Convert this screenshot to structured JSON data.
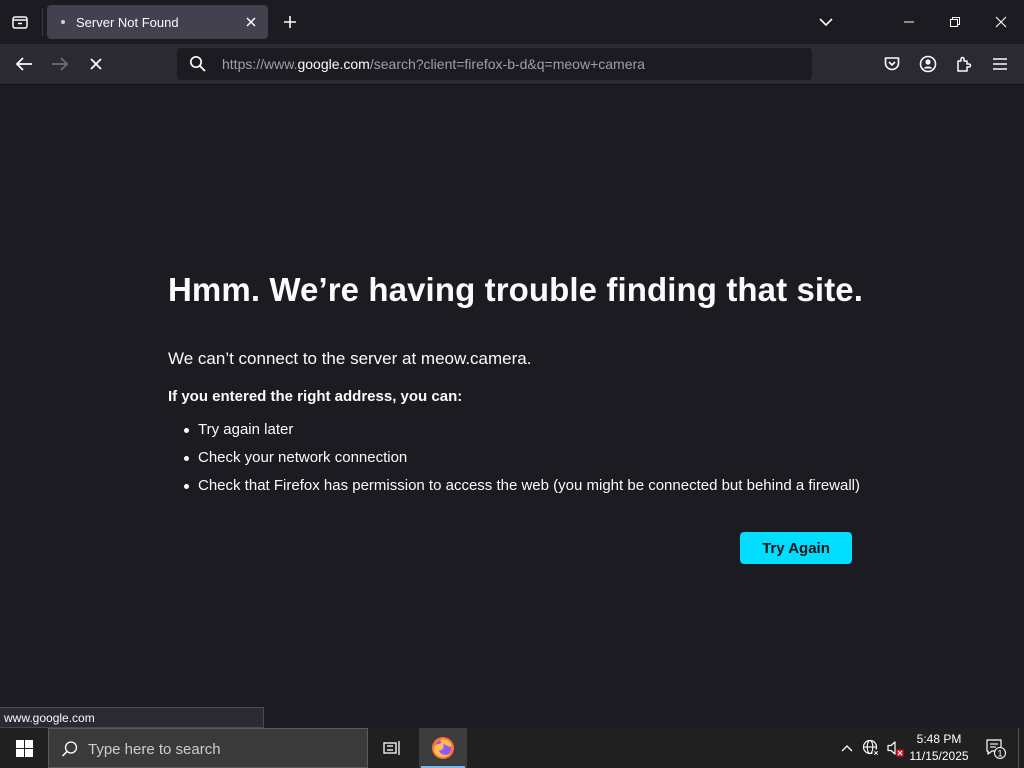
{
  "browser": {
    "tab": {
      "title": "Server Not Found"
    },
    "url_prefix": "https://www.",
    "url_domain": "google.com",
    "url_rest": "/search?client=firefox-b-d&q=meow+camera"
  },
  "error_page": {
    "title": "Hmm. We’re having trouble finding that site.",
    "description": "We can’t connect to the server at meow.camera.",
    "subheading": "If you entered the right address, you can:",
    "suggestions": [
      "Try again later",
      "Check your network connection",
      "Check that Firefox has permission to access the web (you might be connected but behind a firewall)"
    ],
    "try_again_label": "Try Again"
  },
  "status_bar": {
    "text": "www.google.com"
  },
  "taskbar": {
    "search_placeholder": "Type here to search",
    "time": "5:48 PM",
    "date": "11/15/2025",
    "notification_count": "1"
  },
  "colors": {
    "accent": "#00ddff",
    "page_bg": "#1c1b22",
    "toolbar_bg": "#2b2a33"
  },
  "icons": [
    "list-all-tabs-icon",
    "close-icon",
    "plus-icon",
    "chevron-down-icon",
    "minimize-icon",
    "restore-icon",
    "window-close-icon",
    "back-arrow-icon",
    "forward-arrow-icon",
    "stop-icon",
    "search-icon",
    "pocket-icon",
    "account-icon",
    "extensions-icon",
    "menu-icon",
    "windows-start-icon",
    "task-view-icon",
    "firefox-icon",
    "chevron-up-icon",
    "network-icon",
    "volume-muted-icon",
    "notification-icon"
  ]
}
